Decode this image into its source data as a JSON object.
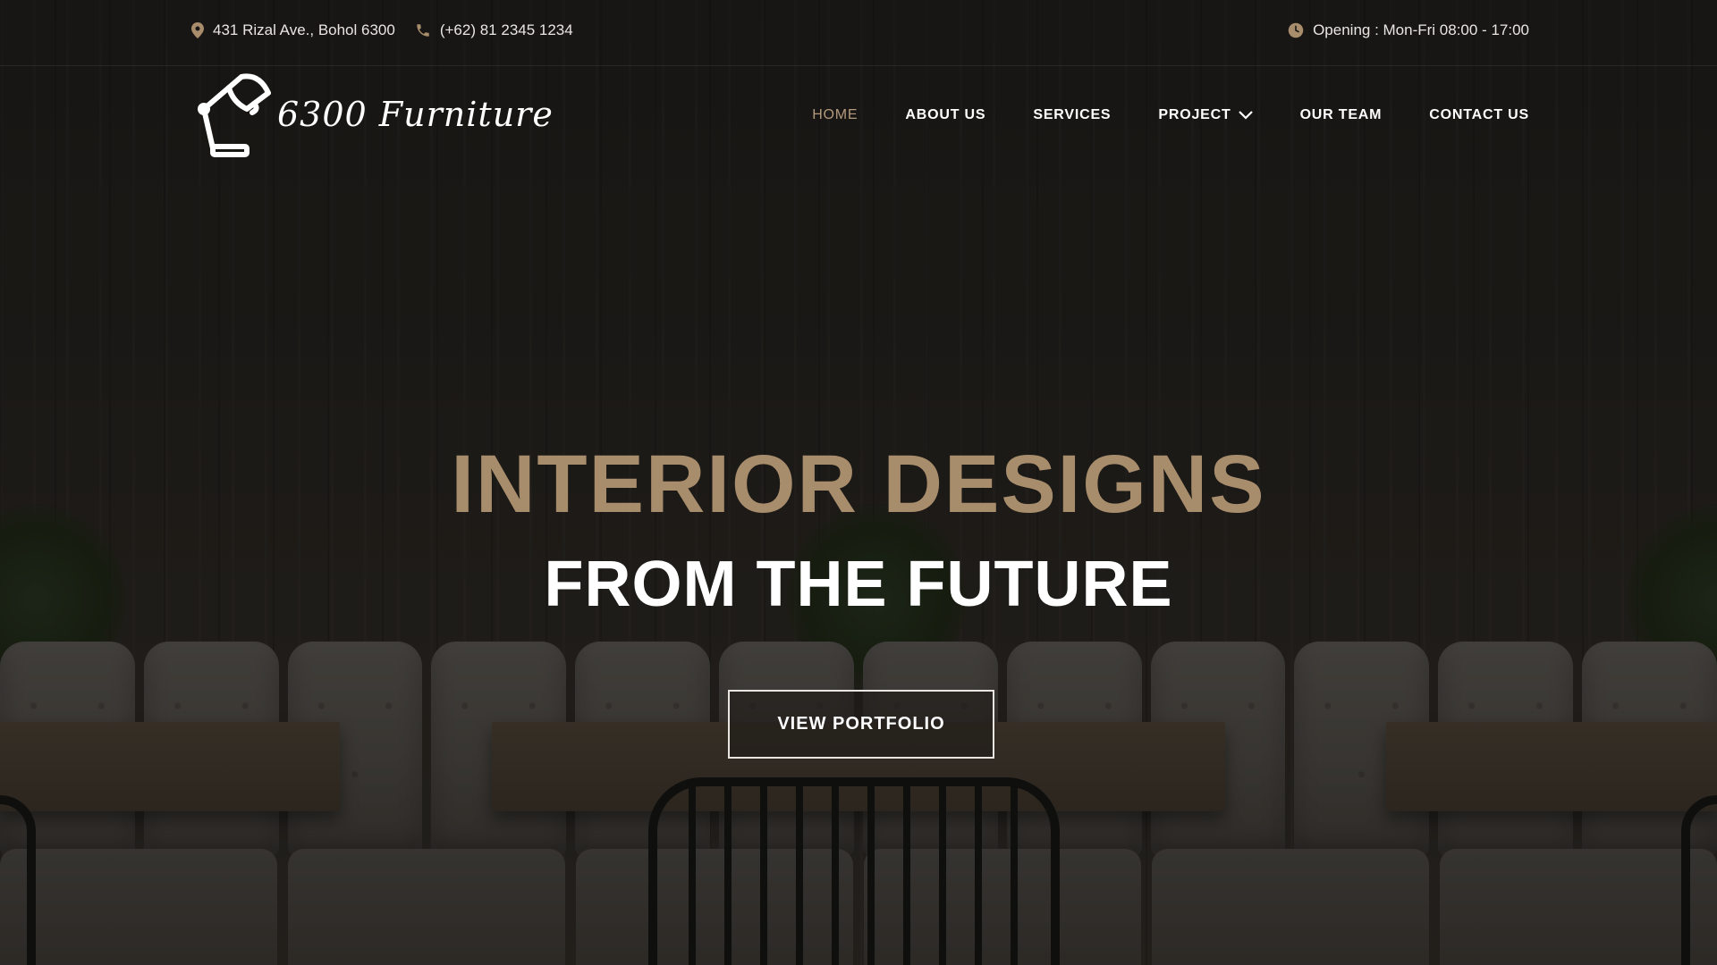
{
  "topbar": {
    "address": "431 Rizal Ave., Bohol 6300",
    "phone": "(+62) 81 2345 1234",
    "opening": "Opening : Mon-Fri 08:00 - 17:00",
    "icons": [
      "map-pin-icon",
      "phone-icon",
      "clock-icon"
    ]
  },
  "brand": {
    "name": "6300 Furniture",
    "logo_icon": "desk-lamp-icon"
  },
  "nav": {
    "items": [
      {
        "label": "HOME",
        "active": true
      },
      {
        "label": "ABOUT US"
      },
      {
        "label": "SERVICES"
      },
      {
        "label": "PROJECT",
        "dropdown": true
      },
      {
        "label": "OUR TEAM"
      },
      {
        "label": "CONTACT US"
      }
    ]
  },
  "hero": {
    "title": "INTERIOR DESIGNS",
    "subtitle": "FROM THE FUTURE",
    "cta_label": "VIEW PORTFOLIO"
  },
  "colors": {
    "accent": "#a88d6d",
    "nav_active": "#b39a7c",
    "background": "#1d1a17",
    "text": "#ffffff"
  }
}
